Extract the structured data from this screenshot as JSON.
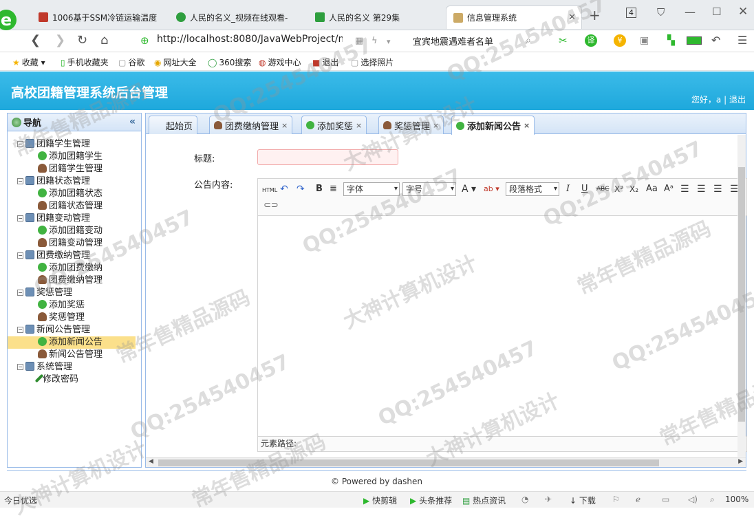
{
  "browser": {
    "tabs": [
      {
        "title": "1006基于SSM冷链运输温度",
        "favicon_color": "#c0392b",
        "active": false
      },
      {
        "title": "人民的名义_视频在线观看-",
        "favicon_color": "#2e9e3e",
        "active": false
      },
      {
        "title": "人民的名义 第29集",
        "favicon_color": "#2e9e3e",
        "active": false
      },
      {
        "title": "信息管理系统",
        "favicon_color": "#ccaa66",
        "active": true
      }
    ],
    "tab_count": "4",
    "url": "http://localhost:8080/JavaWebProject/m",
    "search_text": "宜宾地震遇难者名单",
    "bookmarks": [
      {
        "label": "收藏",
        "icon": "star-icon"
      },
      {
        "label": "手机收藏夹",
        "icon": "phone-icon"
      },
      {
        "label": "谷歌",
        "icon": "page-icon"
      },
      {
        "label": "网址大全",
        "icon": "globe-icon"
      },
      {
        "label": "360搜索",
        "icon": "search-360-icon"
      },
      {
        "label": "游戏中心",
        "icon": "game-icon"
      },
      {
        "label": "退出",
        "icon": "exit-icon"
      },
      {
        "label": "选择照片",
        "icon": "page-icon"
      }
    ]
  },
  "app": {
    "title": "高校团籍管理系统后台管理",
    "greeting": "您好，a",
    "separator": "|",
    "logout": "退出",
    "nav_title": "导航",
    "collapse_glyph": "«",
    "tree": [
      {
        "label": "团籍学生管理",
        "children": [
          {
            "label": "添加团籍学生",
            "icon": "add"
          },
          {
            "label": "团籍学生管理",
            "icon": "user"
          }
        ]
      },
      {
        "label": "团籍状态管理",
        "children": [
          {
            "label": "添加团籍状态",
            "icon": "add"
          },
          {
            "label": "团籍状态管理",
            "icon": "user"
          }
        ]
      },
      {
        "label": "团籍变动管理",
        "children": [
          {
            "label": "添加团籍变动",
            "icon": "add"
          },
          {
            "label": "团籍变动管理",
            "icon": "user"
          }
        ]
      },
      {
        "label": "团费缴纳管理",
        "children": [
          {
            "label": "添加团费缴纳",
            "icon": "add"
          },
          {
            "label": "团费缴纳管理",
            "icon": "user"
          }
        ]
      },
      {
        "label": "奖惩管理",
        "children": [
          {
            "label": "添加奖惩",
            "icon": "add"
          },
          {
            "label": "奖惩管理",
            "icon": "user"
          }
        ]
      },
      {
        "label": "新闻公告管理",
        "children": [
          {
            "label": "添加新闻公告",
            "icon": "add",
            "selected": true
          },
          {
            "label": "新闻公告管理",
            "icon": "user"
          }
        ]
      },
      {
        "label": "系统管理",
        "children": [
          {
            "label": "修改密码",
            "icon": "pen"
          }
        ]
      }
    ],
    "content_tabs": [
      {
        "label": "起始页",
        "icon": "none",
        "closable": false
      },
      {
        "label": "团费缴纳管理",
        "icon": "user",
        "closable": true
      },
      {
        "label": "添加奖惩",
        "icon": "add",
        "closable": true
      },
      {
        "label": "奖惩管理",
        "icon": "user",
        "closable": true
      },
      {
        "label": "添加新闻公告",
        "icon": "add",
        "closable": true,
        "active": true
      }
    ],
    "form": {
      "title_label": "标题:",
      "title_value": "",
      "content_label": "公告内容:"
    },
    "editor": {
      "html_btn": "HTML",
      "bold": "B",
      "font_select": "字体",
      "size_select": "字号",
      "font_color": "A",
      "paragraph_select": "段落格式",
      "italic": "I",
      "underline": "U",
      "strike": "ABC",
      "superscript": "X²",
      "subscript": "X₂",
      "element_path": "元素路径:"
    },
    "footer": "© Powered by dashen"
  },
  "statusbar": {
    "left": "今日优选",
    "items": [
      "快剪辑",
      "头条推荐",
      "热点资讯",
      "下载"
    ],
    "zoom": "100%"
  },
  "watermarks": {
    "qq": "QQ:254540457",
    "shop": "常年售精品源码",
    "design": "大神计算机设计"
  }
}
